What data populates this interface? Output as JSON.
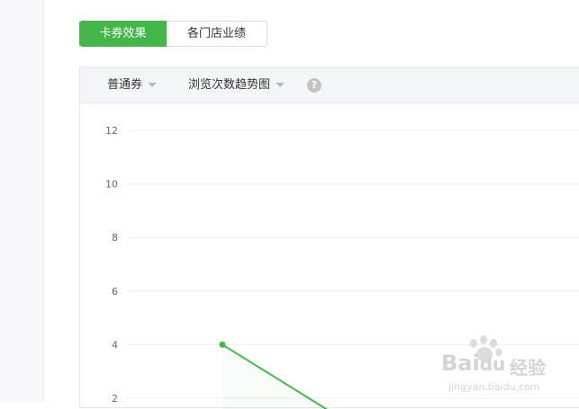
{
  "tabs": [
    {
      "label": "卡券效果",
      "active": true
    },
    {
      "label": "各门店业绩",
      "active": false
    }
  ],
  "filters": {
    "coupon_type": "普通券",
    "metric": "浏览次数趋势图",
    "help_glyph": "?"
  },
  "colors": {
    "accent": "#44b549",
    "line": "#44b549",
    "header_bg": "#f4f5f9"
  },
  "chart_data": {
    "type": "line",
    "title": "",
    "xlabel": "",
    "ylabel": "",
    "ylim": [
      0,
      12
    ],
    "yticks": [
      2,
      4,
      6,
      8,
      10,
      12
    ],
    "grid": true,
    "series": [
      {
        "values": [
          4,
          1.5
        ]
      }
    ]
  },
  "watermark": {
    "brand": "Bai",
    "brand_mid": "du",
    "suffix": "经验",
    "url": "jingyan.baidu.com"
  }
}
